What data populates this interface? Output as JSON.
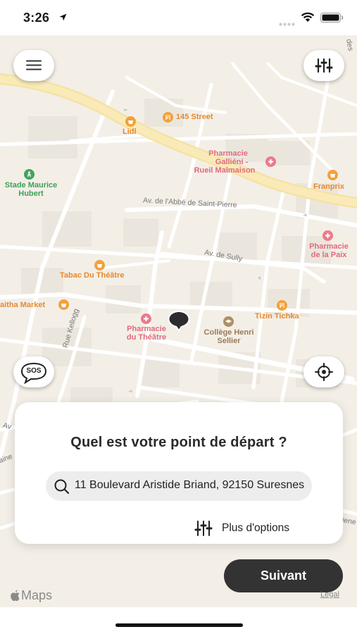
{
  "status_bar": {
    "time": "3:26",
    "icons": [
      "location-arrow-icon",
      "cellular-dots-icon",
      "wifi-icon",
      "battery-icon"
    ]
  },
  "map": {
    "labels": {
      "street_145": "145 Street",
      "lidl": "Lidl",
      "pharmacie_gallieni": [
        "Pharmacie",
        "Galliéni -",
        "Rueil Malmaison"
      ],
      "stade": [
        "Stade Maurice",
        "Hubert"
      ],
      "franprix": "Franprix",
      "abbe": "Av. de l'Abbé de Saint-Pierre",
      "sully": "Av. de Sully",
      "pharmacie_paix": [
        "Pharmacie",
        "de la Paix"
      ],
      "tabac": "Tabac Du Théâtre",
      "aitha": "aitha Market",
      "tizin": "Tizin Tichka",
      "pharmacie_theatre": [
        "Pharmacie",
        "du Théâtre"
      ],
      "college": [
        "Collège Henri",
        "Sellier"
      ],
      "kellogg": "Rue Kellogg",
      "av_left": "Av",
      "aine": "aine",
      "iene": "iene",
      "des": "des"
    },
    "colors": {
      "background": "#f3efe7",
      "road": "#ffffff",
      "major_road": "#f7e6a8",
      "poi_orange": "#f3a13a",
      "poi_pink": "#ea7b8c",
      "poi_green": "#43a35c"
    }
  },
  "buttons": {
    "menu_icon": "menu-icon",
    "filters_icon": "sliders-icon",
    "sos_label": "SOS",
    "locate_icon": "crosshair-icon"
  },
  "departure_card": {
    "title": "Quel est votre point de départ ?",
    "search": {
      "value": "11 Boulevard Aristide Briand, 92150 Suresnes",
      "icon": "search-icon"
    },
    "more_options": "Plus d'options"
  },
  "next_button": "Suivant",
  "attribution": {
    "brand": "Maps",
    "legal": "Legal"
  }
}
